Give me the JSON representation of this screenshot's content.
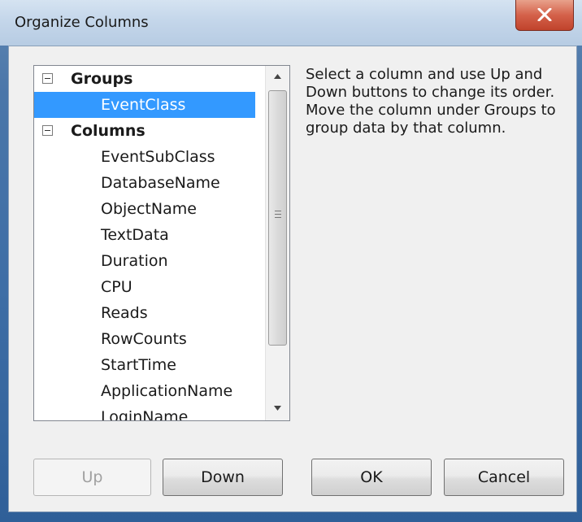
{
  "window": {
    "title": "Organize Columns"
  },
  "tree": {
    "groups_label": "Groups",
    "groups_items": [
      "EventClass"
    ],
    "columns_label": "Columns",
    "columns_items": [
      "EventSubClass",
      "DatabaseName",
      "ObjectName",
      "TextData",
      "Duration",
      "CPU",
      "Reads",
      "RowCounts",
      "StartTime",
      "ApplicationName",
      "LoginName"
    ],
    "selected_item": "EventClass"
  },
  "help": {
    "text": "Select a column and use Up and Down buttons to change its order. Move the column under Groups to group data by that column."
  },
  "buttons": {
    "up": "Up",
    "down": "Down",
    "ok": "OK",
    "cancel": "Cancel"
  },
  "colors": {
    "selection": "#3399ff",
    "close_button": "#c0432c"
  },
  "icons": {
    "close": "close-x-icon",
    "expander": "minus-box-icon",
    "scroll_up": "triangle-up-icon",
    "scroll_down": "triangle-down-icon"
  }
}
